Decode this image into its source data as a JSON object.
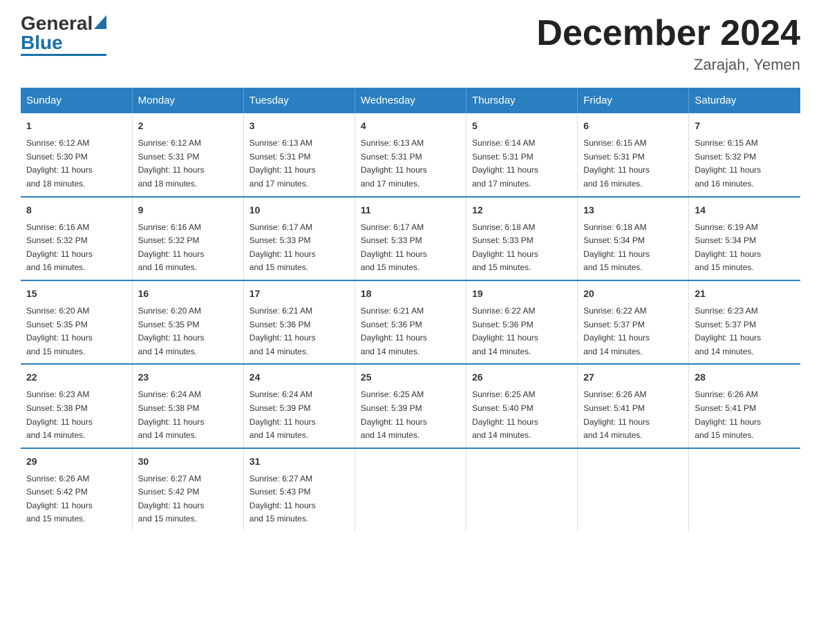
{
  "logo": {
    "general": "General",
    "blue": "Blue"
  },
  "header": {
    "title": "December 2024",
    "subtitle": "Zarajah, Yemen"
  },
  "weekdays": [
    "Sunday",
    "Monday",
    "Tuesday",
    "Wednesday",
    "Thursday",
    "Friday",
    "Saturday"
  ],
  "weeks": [
    [
      {
        "day": "1",
        "sunrise": "6:12 AM",
        "sunset": "5:30 PM",
        "daylight": "11 hours and 18 minutes."
      },
      {
        "day": "2",
        "sunrise": "6:12 AM",
        "sunset": "5:31 PM",
        "daylight": "11 hours and 18 minutes."
      },
      {
        "day": "3",
        "sunrise": "6:13 AM",
        "sunset": "5:31 PM",
        "daylight": "11 hours and 17 minutes."
      },
      {
        "day": "4",
        "sunrise": "6:13 AM",
        "sunset": "5:31 PM",
        "daylight": "11 hours and 17 minutes."
      },
      {
        "day": "5",
        "sunrise": "6:14 AM",
        "sunset": "5:31 PM",
        "daylight": "11 hours and 17 minutes."
      },
      {
        "day": "6",
        "sunrise": "6:15 AM",
        "sunset": "5:31 PM",
        "daylight": "11 hours and 16 minutes."
      },
      {
        "day": "7",
        "sunrise": "6:15 AM",
        "sunset": "5:32 PM",
        "daylight": "11 hours and 16 minutes."
      }
    ],
    [
      {
        "day": "8",
        "sunrise": "6:16 AM",
        "sunset": "5:32 PM",
        "daylight": "11 hours and 16 minutes."
      },
      {
        "day": "9",
        "sunrise": "6:16 AM",
        "sunset": "5:32 PM",
        "daylight": "11 hours and 16 minutes."
      },
      {
        "day": "10",
        "sunrise": "6:17 AM",
        "sunset": "5:33 PM",
        "daylight": "11 hours and 15 minutes."
      },
      {
        "day": "11",
        "sunrise": "6:17 AM",
        "sunset": "5:33 PM",
        "daylight": "11 hours and 15 minutes."
      },
      {
        "day": "12",
        "sunrise": "6:18 AM",
        "sunset": "5:33 PM",
        "daylight": "11 hours and 15 minutes."
      },
      {
        "day": "13",
        "sunrise": "6:18 AM",
        "sunset": "5:34 PM",
        "daylight": "11 hours and 15 minutes."
      },
      {
        "day": "14",
        "sunrise": "6:19 AM",
        "sunset": "5:34 PM",
        "daylight": "11 hours and 15 minutes."
      }
    ],
    [
      {
        "day": "15",
        "sunrise": "6:20 AM",
        "sunset": "5:35 PM",
        "daylight": "11 hours and 15 minutes."
      },
      {
        "day": "16",
        "sunrise": "6:20 AM",
        "sunset": "5:35 PM",
        "daylight": "11 hours and 14 minutes."
      },
      {
        "day": "17",
        "sunrise": "6:21 AM",
        "sunset": "5:36 PM",
        "daylight": "11 hours and 14 minutes."
      },
      {
        "day": "18",
        "sunrise": "6:21 AM",
        "sunset": "5:36 PM",
        "daylight": "11 hours and 14 minutes."
      },
      {
        "day": "19",
        "sunrise": "6:22 AM",
        "sunset": "5:36 PM",
        "daylight": "11 hours and 14 minutes."
      },
      {
        "day": "20",
        "sunrise": "6:22 AM",
        "sunset": "5:37 PM",
        "daylight": "11 hours and 14 minutes."
      },
      {
        "day": "21",
        "sunrise": "6:23 AM",
        "sunset": "5:37 PM",
        "daylight": "11 hours and 14 minutes."
      }
    ],
    [
      {
        "day": "22",
        "sunrise": "6:23 AM",
        "sunset": "5:38 PM",
        "daylight": "11 hours and 14 minutes."
      },
      {
        "day": "23",
        "sunrise": "6:24 AM",
        "sunset": "5:38 PM",
        "daylight": "11 hours and 14 minutes."
      },
      {
        "day": "24",
        "sunrise": "6:24 AM",
        "sunset": "5:39 PM",
        "daylight": "11 hours and 14 minutes."
      },
      {
        "day": "25",
        "sunrise": "6:25 AM",
        "sunset": "5:39 PM",
        "daylight": "11 hours and 14 minutes."
      },
      {
        "day": "26",
        "sunrise": "6:25 AM",
        "sunset": "5:40 PM",
        "daylight": "11 hours and 14 minutes."
      },
      {
        "day": "27",
        "sunrise": "6:26 AM",
        "sunset": "5:41 PM",
        "daylight": "11 hours and 14 minutes."
      },
      {
        "day": "28",
        "sunrise": "6:26 AM",
        "sunset": "5:41 PM",
        "daylight": "11 hours and 15 minutes."
      }
    ],
    [
      {
        "day": "29",
        "sunrise": "6:26 AM",
        "sunset": "5:42 PM",
        "daylight": "11 hours and 15 minutes."
      },
      {
        "day": "30",
        "sunrise": "6:27 AM",
        "sunset": "5:42 PM",
        "daylight": "11 hours and 15 minutes."
      },
      {
        "day": "31",
        "sunrise": "6:27 AM",
        "sunset": "5:43 PM",
        "daylight": "11 hours and 15 minutes."
      },
      null,
      null,
      null,
      null
    ]
  ],
  "cell_labels": {
    "sunrise": "Sunrise:",
    "sunset": "Sunset:",
    "daylight": "Daylight:"
  }
}
